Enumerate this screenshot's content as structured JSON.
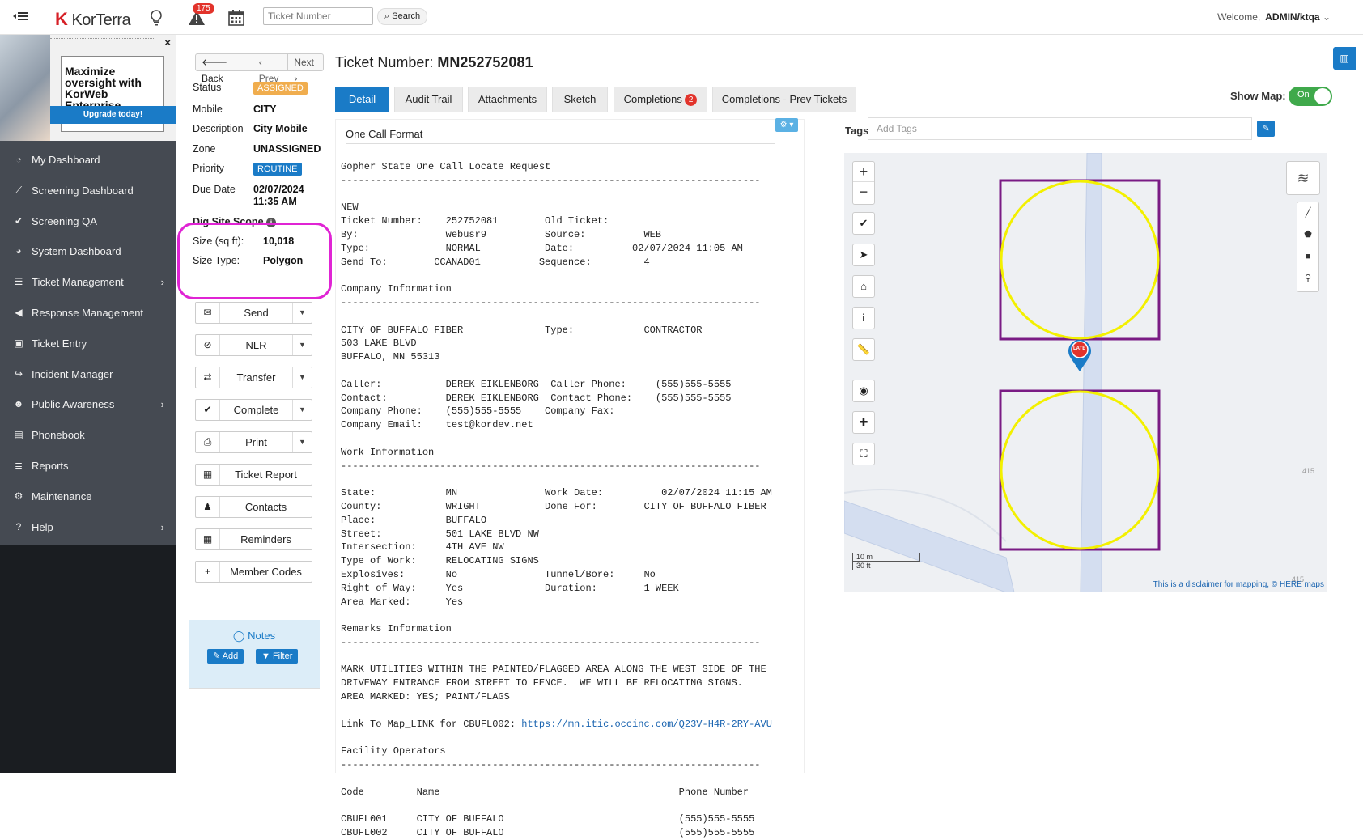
{
  "topbar": {
    "logo_k": "K",
    "logo_text": "KorTerra",
    "alert_count": "175",
    "ticket_placeholder": "Ticket Number",
    "search_label": "Search",
    "welcome": "Welcome,",
    "user": "ADMIN/ktqa"
  },
  "promo": {
    "headline": "Maximize oversight with KorWeb Enterprise",
    "cta": "Upgrade today!",
    "close": "×"
  },
  "sidebar": {
    "items": [
      {
        "label": "My Dashboard",
        "icon": "dashboard-icon",
        "glyph": "◔"
      },
      {
        "label": "Screening Dashboard",
        "icon": "line-chart-icon",
        "glyph": "⟋"
      },
      {
        "label": "Screening QA",
        "icon": "check-circle-icon",
        "glyph": "✔"
      },
      {
        "label": "System Dashboard",
        "icon": "gauge-icon",
        "glyph": "◕"
      },
      {
        "label": "Ticket Management",
        "icon": "list-icon",
        "glyph": "☰",
        "chevron": "›"
      },
      {
        "label": "Response Management",
        "icon": "megaphone-icon",
        "glyph": "◀"
      },
      {
        "label": "Ticket Entry",
        "icon": "briefcase-icon",
        "glyph": "▣"
      },
      {
        "label": "Incident Manager",
        "icon": "share-icon",
        "glyph": "↪"
      },
      {
        "label": "Public Awareness",
        "icon": "users-icon",
        "glyph": "☻",
        "chevron": "›"
      },
      {
        "label": "Phonebook",
        "icon": "book-icon",
        "glyph": "▤"
      },
      {
        "label": "Reports",
        "icon": "reports-icon",
        "glyph": "≣"
      },
      {
        "label": "Maintenance",
        "icon": "cogs-icon",
        "glyph": "⚙"
      },
      {
        "label": "Help",
        "icon": "help-icon",
        "glyph": "?",
        "chevron": "›"
      }
    ]
  },
  "ticket_nav": {
    "back": "Back",
    "prev": "‹ Prev",
    "next": "Next ›"
  },
  "details": {
    "status_label": "Status",
    "status": "ASSIGNED",
    "mobile_label": "Mobile",
    "mobile": "CITY",
    "description_label": "Description",
    "description": "City Mobile",
    "zone_label": "Zone",
    "zone": "UNASSIGNED",
    "priority_label": "Priority",
    "priority": "ROUTINE",
    "due_label": "Due Date",
    "due_date": "02/07/2024",
    "due_time": "11:35 AM"
  },
  "dig_site": {
    "title": "Dig Site Scope",
    "size_label": "Size (sq ft):",
    "size": "10,018",
    "type_label": "Size Type:",
    "type": "Polygon"
  },
  "actions": [
    {
      "label": "Send",
      "glyph": "✉",
      "icon": "envelope-icon",
      "dropdown": true
    },
    {
      "label": "NLR",
      "glyph": "⊘",
      "icon": "ban-icon",
      "dropdown": true
    },
    {
      "label": "Transfer",
      "glyph": "⇄",
      "icon": "exchange-icon",
      "dropdown": true
    },
    {
      "label": "Complete",
      "glyph": "✔",
      "icon": "check-icon",
      "dropdown": true
    },
    {
      "label": "Print",
      "glyph": "⎙",
      "icon": "print-icon",
      "dropdown": true
    },
    {
      "label": "Ticket Report",
      "glyph": "▦",
      "icon": "report-icon",
      "dropdown": false
    },
    {
      "label": "Contacts",
      "glyph": "♟",
      "icon": "user-icon",
      "dropdown": false
    },
    {
      "label": "Reminders",
      "glyph": "▦",
      "icon": "calendar-icon",
      "dropdown": false
    },
    {
      "label": "Member Codes",
      "glyph": "+",
      "icon": "plus-icon",
      "dropdown": false
    }
  ],
  "notes": {
    "title": "Notes",
    "add": "Add",
    "filter": "Filter"
  },
  "main": {
    "ticket_label": "Ticket Number:",
    "ticket_number": "MN252752081",
    "tabs": [
      {
        "label": "Detail"
      },
      {
        "label": "Audit Trail"
      },
      {
        "label": "Attachments"
      },
      {
        "label": "Sketch"
      },
      {
        "label": "Completions",
        "count": "2"
      },
      {
        "label": "Completions - Prev Tickets"
      }
    ],
    "show_map_label": "Show Map:",
    "toggle": "On",
    "format_label": "One Call Format",
    "tags_label": "Tags",
    "tags_placeholder": "Add Tags",
    "ticket_text_before_link": "Gopher State One Call Locate Request\n------------------------------------------------------------------------\n\nNEW\nTicket Number:    252752081        Old Ticket:\nBy:               webusr9          Source:          WEB\nType:             NORMAL           Date:          02/07/2024 11:05 AM\nSend To:        CCANAD01          Sequence:         4\n\nCompany Information\n------------------------------------------------------------------------\n\nCITY OF BUFFALO FIBER              Type:            CONTRACTOR\n503 LAKE BLVD\nBUFFALO, MN 55313\n\nCaller:           DEREK EIKLENBORG  Caller Phone:     (555)555-5555\nContact:          DEREK EIKLENBORG  Contact Phone:    (555)555-5555\nCompany Phone:    (555)555-5555    Company Fax:\nCompany Email:    test@kordev.net\n\nWork Information\n------------------------------------------------------------------------\n\nState:            MN               Work Date:          02/07/2024 11:15 AM\nCounty:           WRIGHT           Done For:        CITY OF BUFFALO FIBER\nPlace:            BUFFALO\nStreet:           501 LAKE BLVD NW\nIntersection:     4TH AVE NW\nType of Work:     RELOCATING SIGNS\nExplosives:       No               Tunnel/Bore:     No\nRight of Way:     Yes              Duration:        1 WEEK\nArea Marked:      Yes\n\nRemarks Information\n------------------------------------------------------------------------\n\nMARK UTILITIES WITHIN THE PAINTED/FLAGGED AREA ALONG THE WEST SIDE OF THE\nDRIVEWAY ENTRANCE FROM STREET TO FENCE.  WE WILL BE RELOCATING SIGNS.\nAREA MARKED: YES; PAINT/FLAGS\n\nLink To Map_LINK for CBUFL002: ",
    "map_link": "https://mn.itic.occinc.com/Q23V-H4R-2RY-AVU",
    "ticket_text_after_link": "\n\nFacility Operators\n------------------------------------------------------------------------\n\nCode         Name                                         Phone Number\n\nCBUFL001     CITY OF BUFFALO                              (555)555-5555\nCBUFL002     CITY OF BUFFALO                              (555)555-5555"
  },
  "map": {
    "marker_label": "LATE",
    "scale_m": "10 m",
    "scale_ft": "30 ft",
    "contour_1": "415",
    "contour_2": "415",
    "disclaimer": "This is a disclaimer for mapping,",
    "attribution": "© HERE maps"
  }
}
